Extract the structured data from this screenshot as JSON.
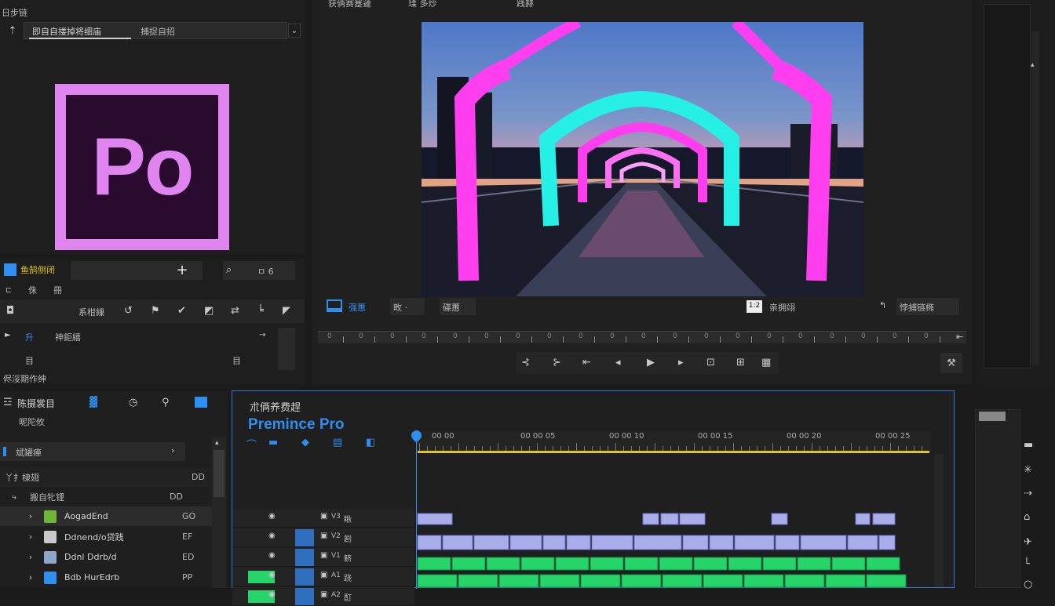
{
  "top_left": {
    "title": "日步链"
  },
  "source_panel": {
    "tab_active": "即自自搂掉将细庙",
    "tab_other": "捕捉自招",
    "logo_text": "Po"
  },
  "project_panel": {
    "title": "鱼鹄侧闭",
    "add": "+",
    "search_label": "ㅁ 6",
    "filter_left": "ㄷ",
    "filter_mid": "侏",
    "filter_right": "冊",
    "toolbar_label": "系柑繅",
    "list_a": "升",
    "list_a_label": "神鉅繥",
    "list_b": "目",
    "list_b_right": "目",
    "footer": "侭浽期作绅"
  },
  "monitor": {
    "header_a": "获俩赛蹇蘧",
    "header_b": "瑈 多炒",
    "header_c": "践赫",
    "tab_active": "强蕙",
    "tab_b": "畋 ‧",
    "tab_c": "碟蕙",
    "fit_badge": "1:2",
    "fit_label": "亲拥翊",
    "quality_label": "悖捕链椭",
    "ruler_labels": [
      "0",
      "0",
      "0",
      "0",
      "0",
      "0",
      "0",
      "0",
      "0",
      "0",
      "0",
      "0",
      "0",
      "0",
      "0",
      "0",
      "0",
      "0",
      "0",
      "0"
    ]
  },
  "effects_panel": {
    "title": "陈摄裳目",
    "sub": "昵陀攸",
    "section": "斌罐瘅",
    "group": "丫扌棣翅",
    "group_right": "DD",
    "sub_group": "搬自牝锂",
    "sub_group_right": "DD",
    "items": [
      {
        "name": "AogadEnd",
        "right": "GO",
        "color": "#6fb437"
      },
      {
        "name": "Ddnend/o贷践",
        "right": "EF",
        "color": "#c9c9c9"
      },
      {
        "name": "Ddnl Ddrb/d",
        "right": "ED",
        "color": "#8ea7c9"
      },
      {
        "name": "Bdb HurEdrb",
        "right": "PP",
        "color": "#2f8ff0"
      }
    ]
  },
  "timeline": {
    "title": "朮俩养费趕",
    "brand": "Premince Pro",
    "ruler_labels": [
      "00 00",
      "00 00 05",
      "00 00 10",
      "00 00 15",
      "00 00 20",
      "00 00 25"
    ],
    "tracks": [
      {
        "label": "V3",
        "name": "瞅"
      },
      {
        "label": "V2",
        "name": "剧"
      },
      {
        "label": "V1",
        "name": "鲚"
      },
      {
        "label": "A1",
        "name": "跷"
      },
      {
        "label": "A2",
        "name": "酊"
      }
    ]
  },
  "colors": {
    "accent": "#2f8ff0",
    "magenta": "#e084ef",
    "yellow": "#e4c21d",
    "audio": "#27d46a",
    "video": "#a9aeea"
  }
}
